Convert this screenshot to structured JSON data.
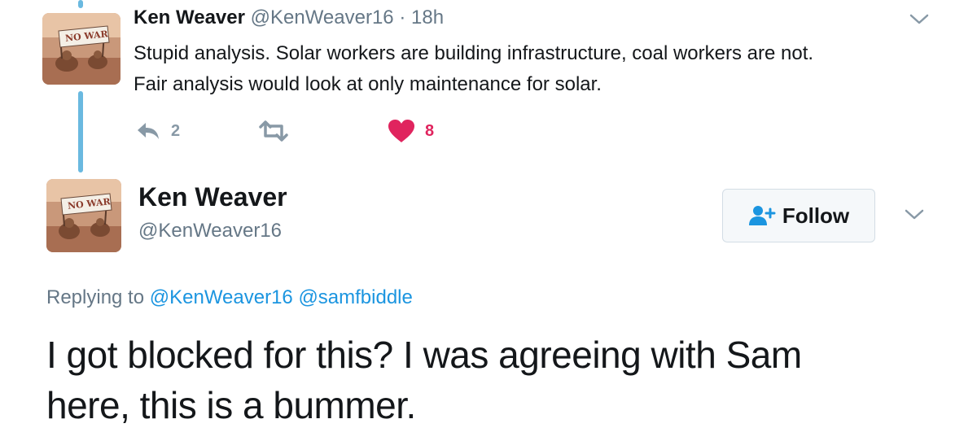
{
  "parent_tweet": {
    "author_name": "Ken Weaver",
    "handle": "@KenWeaver16",
    "separator": "·",
    "time": "18h",
    "body_line1": "Stupid analysis. Solar workers are building infrastructure, coal workers are not.",
    "body_line2": "Fair analysis would look at only maintenance for solar.",
    "actions": {
      "reply_icon": "reply-icon",
      "reply_count": "2",
      "retweet_icon": "retweet-icon",
      "retweet_count": "",
      "like_icon": "heart-icon",
      "like_count": "8"
    },
    "avatar_sign_text": "NO WAR"
  },
  "main_tweet": {
    "author_name": "Ken Weaver",
    "handle": "@KenWeaver16",
    "avatar_sign_text": "NO WAR",
    "follow_button": {
      "label": "Follow",
      "icon": "add-person-icon"
    },
    "replying_prefix": "Replying to",
    "replying_to": [
      "@KenWeaver16",
      "@samfbiddle"
    ],
    "text_line1": "I got blocked for this? I was agreeing with Sam",
    "text_line2": "here, this is a bummer."
  },
  "colors": {
    "thread_line": "#6ab9e0",
    "link": "#1b95e0",
    "muted": "#657786",
    "like": "#e0245e"
  }
}
